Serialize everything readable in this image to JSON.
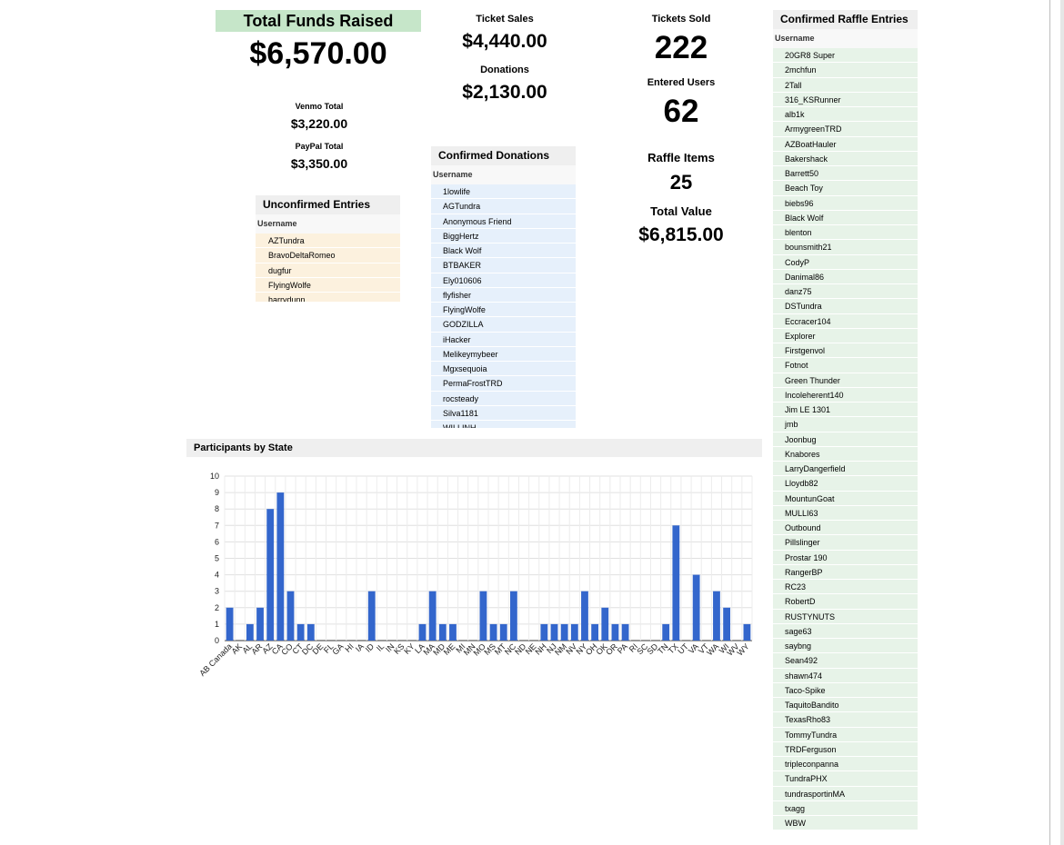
{
  "summary": {
    "total_funds_label": "Total Funds Raised",
    "total_funds_value": "$6,570.00",
    "venmo_label": "Venmo Total",
    "venmo_value": "$3,220.00",
    "paypal_label": "PayPal Total",
    "paypal_value": "$3,350.00",
    "ticket_sales_label": "Ticket Sales",
    "ticket_sales_value": "$4,440.00",
    "donations_label": "Donations",
    "donations_value": "$2,130.00",
    "tickets_sold_label": "Tickets Sold",
    "tickets_sold_value": "222",
    "entered_users_label": "Entered Users",
    "entered_users_value": "62",
    "raffle_items_label": "Raffle Items",
    "raffle_items_value": "25",
    "total_value_label": "Total Value",
    "total_value_value": "$6,815.00"
  },
  "unconfirmed": {
    "title": "Unconfirmed Entries",
    "column": "Username",
    "rows": [
      "AZTundra",
      "BravoDeltaRomeo",
      "dugfur",
      "FlyingWolfe",
      "harrydunn"
    ]
  },
  "confirmed_donations": {
    "title": "Confirmed Donations",
    "column": "Username",
    "rows": [
      "1lowlife",
      "AGTundra",
      "Anonymous Friend",
      "BiggHertz",
      "Black Wolf",
      "BTBAKER",
      "Ely010606",
      "flyfisher",
      "FlyingWolfe",
      "GODZILLA",
      "iHacker",
      "Melikeymybeer",
      "Mgxsequoia",
      "PermaFrostTRD",
      "rocsteady",
      "Silva1181",
      "WILLINH"
    ]
  },
  "raffle_entries": {
    "title": "Confirmed Raffle Entries",
    "column": "Username",
    "rows": [
      "20GR8 Super",
      "2mchfun",
      "2Tall",
      "316_KSRunner",
      "alb1k",
      "ArmygreenTRD",
      "AZBoatHauler",
      "Bakershack",
      "Barrett50",
      "Beach Toy",
      "biebs96",
      "Black Wolf",
      "blenton",
      "bounsmith21",
      "CodyP",
      "Danimal86",
      "danz75",
      "DSTundra",
      "Eccracer104",
      "Explorer",
      "Firstgenvol",
      "Fotnot",
      "Green Thunder",
      "Incoleherent140",
      "Jim LE 1301",
      "jmb",
      "Joonbug",
      "Knabores",
      "LarryDangerfield",
      "Lloydb82",
      "MountunGoat",
      "MULLI63",
      "Outbound",
      "Pillslinger",
      "Prostar 190",
      "RangerBP",
      "RC23",
      "RobertD",
      "RUSTYNUTS",
      "sage63",
      "saybng",
      "Sean492",
      "shawn474",
      "Taco-Spike",
      "TaquitoBandito",
      "TexasRho83",
      "TommyTundra",
      "TRDFerguson",
      "tripleconpanna",
      "TundraPHX",
      "tundrasportinMA",
      "txagg",
      "WBW"
    ]
  },
  "chart_title": "Participants by State",
  "chart_data": {
    "type": "bar",
    "title": "Participants by State",
    "xlabel": "",
    "ylabel": "",
    "ylim": [
      0,
      10
    ],
    "yticks": [
      0,
      1,
      2,
      3,
      4,
      5,
      6,
      7,
      8,
      9,
      10
    ],
    "grid": true,
    "bar_color": "#3366cc",
    "categories": [
      "AB Canada",
      "AK",
      "AL",
      "AR",
      "AZ",
      "CA",
      "CO",
      "CT",
      "DC",
      "DE",
      "FL",
      "GA",
      "HI",
      "IA",
      "ID",
      "IL",
      "IN",
      "KS",
      "KY",
      "LA",
      "MA",
      "MD",
      "ME",
      "MI",
      "MN",
      "MO",
      "MS",
      "MT",
      "NC",
      "ND",
      "NE",
      "NH",
      "NJ",
      "NM",
      "NV",
      "NY",
      "OH",
      "OK",
      "OR",
      "PA",
      "RI",
      "SC",
      "SD",
      "TN",
      "TX",
      "UT",
      "VA",
      "VT",
      "WA",
      "WI",
      "WV",
      "WY"
    ],
    "values": [
      2,
      0,
      1,
      2,
      8,
      9,
      3,
      1,
      1,
      0,
      0,
      0,
      0,
      0,
      3,
      0,
      0,
      0,
      0,
      1,
      3,
      1,
      1,
      0,
      0,
      3,
      1,
      1,
      3,
      0,
      0,
      1,
      1,
      1,
      1,
      3,
      1,
      2,
      1,
      1,
      0,
      0,
      0,
      1,
      7,
      0,
      4,
      0,
      3,
      2,
      0,
      1
    ]
  },
  "colors": {
    "total_header_bg": "#c6e6c9",
    "unconfirmed_row_bg": "#fcf1de",
    "donation_row_bg": "#e6f0fb",
    "raffle_row_bg": "#e7f3e8",
    "bar": "#3366cc"
  }
}
